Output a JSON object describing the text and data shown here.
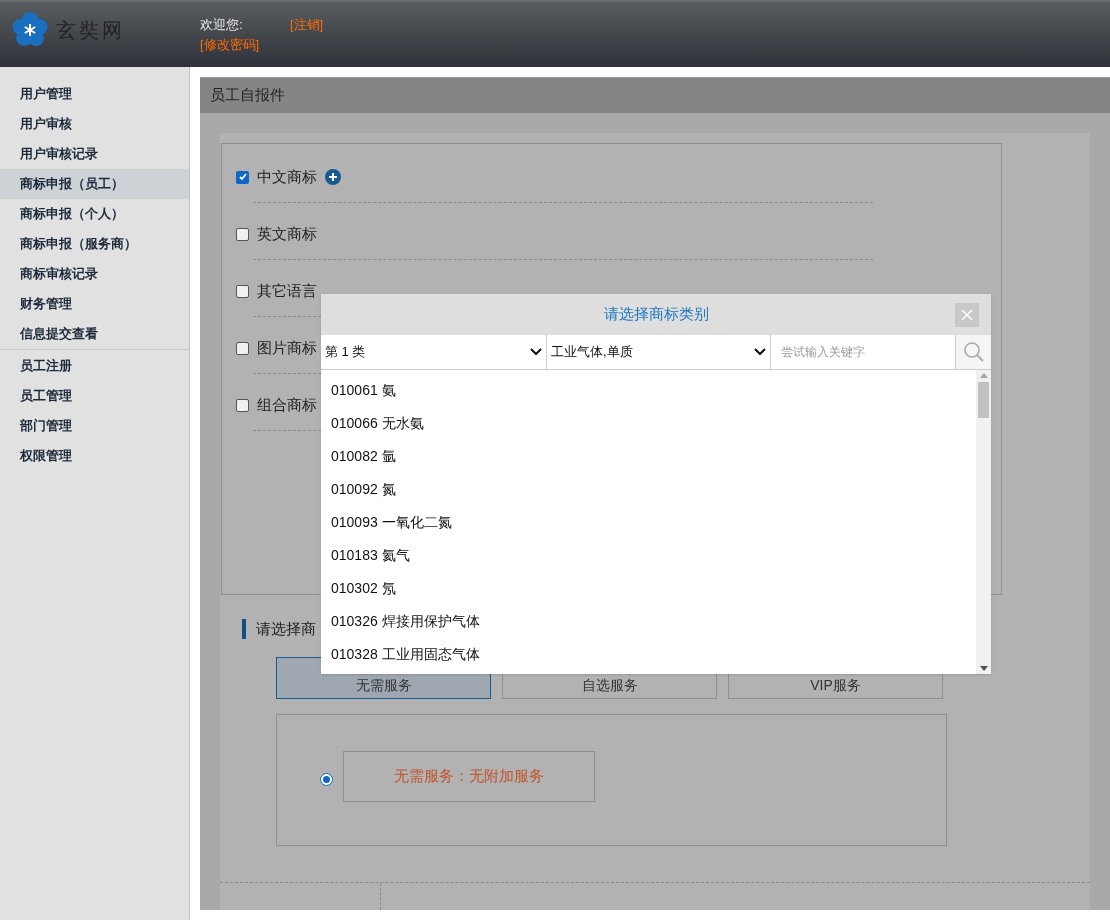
{
  "header": {
    "logo_text": "玄奘网",
    "welcome": "欢迎您:",
    "logout": "[注销]",
    "change_password": "[修改密码]"
  },
  "sidebar": {
    "groups": [
      {
        "items": [
          {
            "label": "用户管理",
            "selected": false
          },
          {
            "label": "用户审核",
            "selected": false
          },
          {
            "label": "用户审核记录",
            "selected": false
          },
          {
            "label": "商标申报（员工）",
            "selected": true
          },
          {
            "label": "商标申报（个人）",
            "selected": false
          },
          {
            "label": "商标申报（服务商）",
            "selected": false
          },
          {
            "label": "商标审核记录",
            "selected": false
          },
          {
            "label": "财务管理",
            "selected": false
          },
          {
            "label": "信息提交查看",
            "selected": false
          }
        ]
      },
      {
        "items": [
          {
            "label": "员工注册",
            "selected": false
          },
          {
            "label": "员工管理",
            "selected": false
          },
          {
            "label": "部门管理",
            "selected": false
          },
          {
            "label": "权限管理",
            "selected": false
          }
        ]
      }
    ]
  },
  "panel": {
    "title": "员工自报件",
    "trademark_types": [
      {
        "label": "中文商标",
        "checked": true,
        "add_button": true
      },
      {
        "label": "英文商标",
        "checked": false,
        "add_button": false
      },
      {
        "label": "其它语言",
        "checked": false,
        "add_button": false
      },
      {
        "label": "图片商标",
        "checked": false,
        "add_button": false
      },
      {
        "label": "组合商标",
        "checked": false,
        "add_button": false
      }
    ],
    "service_title": "请选择商",
    "service_tabs": [
      {
        "label": "无需服务",
        "selected": true
      },
      {
        "label": "自选服务",
        "selected": false
      },
      {
        "label": "VIP服务",
        "selected": false
      }
    ],
    "service_option": {
      "label": "无需服务：无附加服务",
      "selected": true
    }
  },
  "modal": {
    "title": "请选择商标类别",
    "class_select": "第 1 类",
    "group_select": "工业气体,单质",
    "search": {
      "placeholder": "尝试输入关键字"
    },
    "items": [
      "010061 氨",
      "010066 无水氨",
      "010082 氩",
      "010092 氮",
      "010093 一氧化二氮",
      "010183 氦气",
      "010302 氖",
      "010326 焊接用保护气体",
      "010328 工业用固态气体"
    ]
  }
}
